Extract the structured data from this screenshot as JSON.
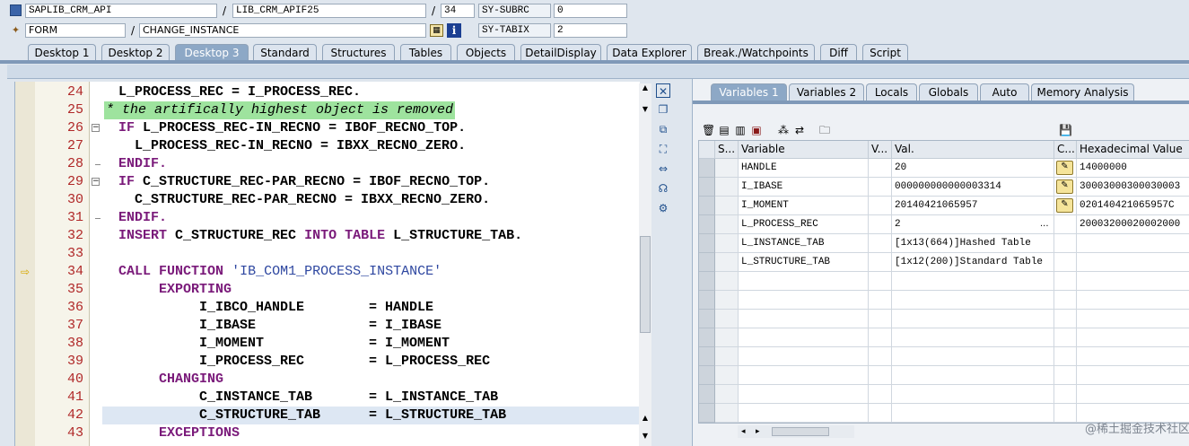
{
  "header": {
    "row1": {
      "program": "SAPLIB_CRM_API",
      "include": "LIB_CRM_APIF25",
      "line": "34",
      "var_name": "SY-SUBRC",
      "var_value": "0"
    },
    "row2": {
      "type": "FORM",
      "name": "CHANGE_INSTANCE",
      "var_name": "SY-TABIX",
      "var_value": "2"
    }
  },
  "main_tabs": [
    "Desktop 1",
    "Desktop 2",
    "Desktop 3",
    "Standard",
    "Structures",
    "Tables",
    "Objects",
    "DetailDisplay",
    "Data Explorer",
    "Break./Watchpoints",
    "Diff",
    "Script"
  ],
  "active_main_tab": "Desktop 3",
  "code": {
    "lines": [
      {
        "n": "24",
        "text": "  L_PROCESS_REC = I_PROCESS_REC."
      },
      {
        "n": "25",
        "text": "* the artifically highest object is removed"
      },
      {
        "n": "26",
        "text": "  IF L_PROCESS_REC-IN_RECNO = IBOF_RECNO_TOP."
      },
      {
        "n": "27",
        "text": "    L_PROCESS_REC-IN_RECNO = IBXX_RECNO_ZERO."
      },
      {
        "n": "28",
        "text": "  ENDIF."
      },
      {
        "n": "29",
        "text": "  IF C_STRUCTURE_REC-PAR_RECNO = IBOF_RECNO_TOP."
      },
      {
        "n": "30",
        "text": "    C_STRUCTURE_REC-PAR_RECNO = IBXX_RECNO_ZERO."
      },
      {
        "n": "31",
        "text": "  ENDIF."
      },
      {
        "n": "32",
        "text": "  INSERT C_STRUCTURE_REC INTO TABLE L_STRUCTURE_TAB."
      },
      {
        "n": "33",
        "text": ""
      },
      {
        "n": "34",
        "text": "  CALL FUNCTION 'IB_COM1_PROCESS_INSTANCE'"
      },
      {
        "n": "35",
        "text": "       EXPORTING"
      },
      {
        "n": "36",
        "text": "            I_IBCO_HANDLE        = HANDLE"
      },
      {
        "n": "37",
        "text": "            I_IBASE              = I_IBASE"
      },
      {
        "n": "38",
        "text": "            I_MOMENT             = I_MOMENT"
      },
      {
        "n": "39",
        "text": "            I_PROCESS_REC        = L_PROCESS_REC"
      },
      {
        "n": "40",
        "text": "       CHANGING"
      },
      {
        "n": "41",
        "text": "            C_INSTANCE_TAB       = L_INSTANCE_TAB"
      },
      {
        "n": "42",
        "text": "            C_STRUCTURE_TAB      = L_STRUCTURE_TAB"
      },
      {
        "n": "43",
        "text": "       EXCEPTIONS"
      }
    ],
    "current_line": "34",
    "comment_line": "25",
    "highlight_line": "42"
  },
  "var_tabs": [
    "Variables 1",
    "Variables 2",
    "Locals",
    "Globals",
    "Auto",
    "Memory Analysis"
  ],
  "active_var_tab": "Variables 1",
  "grid": {
    "headers": [
      "S...",
      "Variable",
      "V...",
      "Val.",
      "C...",
      "Hexadecimal Value"
    ],
    "rows": [
      {
        "variable": "HANDLE",
        "value": "20",
        "edit": true,
        "hex": "14000000"
      },
      {
        "variable": "I_IBASE",
        "value": "000000000000003314",
        "edit": true,
        "hex": "30003000300030003"
      },
      {
        "variable": "I_MOMENT",
        "value": "20140421065957",
        "edit": true,
        "hex": "020140421065957C"
      },
      {
        "variable": "L_PROCESS_REC",
        "value": " 2",
        "value_suffix": "...",
        "edit": false,
        "hex": "20003200020002000"
      },
      {
        "variable": "L_INSTANCE_TAB",
        "value": "[1x13(664)]Hashed Table",
        "edit": false,
        "hex": ""
      },
      {
        "variable": "L_STRUCTURE_TAB",
        "value": "[1x12(200)]Standard Table",
        "edit": false,
        "hex": ""
      }
    ]
  },
  "watermark": "@稀土掘金技术社区"
}
